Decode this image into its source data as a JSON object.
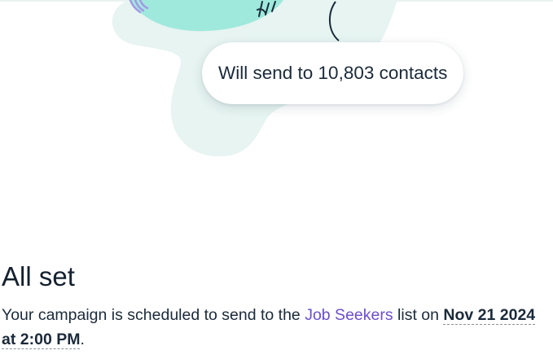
{
  "illustration": {
    "send_summary": "Will send to 10,803 contacts",
    "colors": {
      "blob": "#e7f4f1",
      "planet": "#9fe9dc",
      "accent_purple": "#a597e6",
      "line": "#1b2a3a"
    }
  },
  "confirmation": {
    "title": "All set",
    "sentence_before_list": "Your campaign is scheduled to send to the ",
    "list_name": "Job Seekers",
    "sentence_after_list": " list on ",
    "schedule_datetime": "Nov 21 2024 at 2:00 PM",
    "sentence_end": "."
  },
  "colors": {
    "link": "#6a4fcf",
    "text": "#1b2a3a",
    "background": "#ffffff"
  }
}
